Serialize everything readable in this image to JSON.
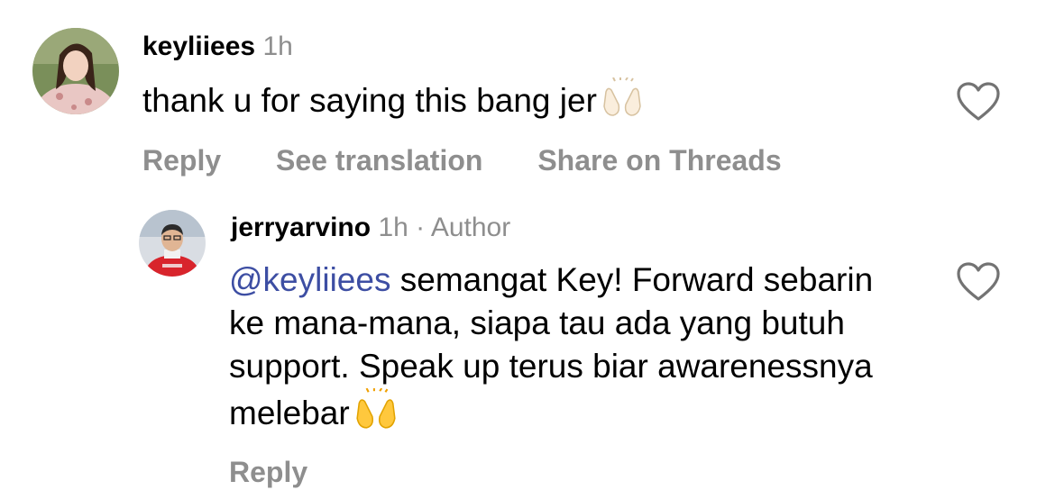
{
  "comments": [
    {
      "username": "keyliiees",
      "time": "1h",
      "text": "thank u for saying this bang jer",
      "emoji": "raising-hands-light",
      "actions": {
        "reply": "Reply",
        "translate": "See translation",
        "threads": "Share on Threads"
      }
    },
    {
      "username": "jerryarvino",
      "time": "1h",
      "separator": "·",
      "badge": "Author",
      "mention": "@keyliiees",
      "text": " semangat Key! Forward sebarin ke mana-mana, siapa tau ada yang butuh support. Speak up terus biar awarenessnya melebar",
      "emoji": "raising-hands-yellow",
      "actions": {
        "reply": "Reply"
      }
    }
  ],
  "icons": {
    "like": "heart-outline-icon"
  },
  "colors": {
    "meta": "#8e8e8e",
    "mention": "#3d4ea3"
  }
}
